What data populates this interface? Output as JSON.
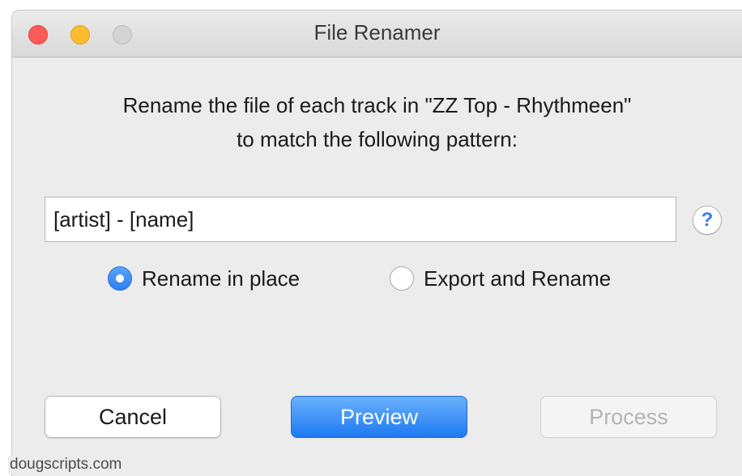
{
  "window": {
    "title": "File Renamer"
  },
  "dialog": {
    "prompt": "Rename the file of each track in \"ZZ Top - Rhythmeen\"\nto match the following pattern:",
    "pattern_value": "[artist] - [name]",
    "help_glyph": "?"
  },
  "options": {
    "rename_in_place": "Rename in place",
    "export_and_rename": "Export and Rename",
    "selected": "Rename in place"
  },
  "buttons": {
    "cancel": "Cancel",
    "preview": "Preview",
    "process": "Process"
  },
  "footer": {
    "credit": "dougscripts.com"
  },
  "colors": {
    "accent": "#2f7ff6",
    "close": "#fc5c58",
    "minimize": "#fdbc2e",
    "zoom_disabled": "#d4d4d4",
    "window_bg": "#ececec"
  },
  "icons": {
    "close": "close-icon",
    "minimize": "minimize-icon",
    "zoom": "zoom-icon",
    "help": "help-icon"
  }
}
